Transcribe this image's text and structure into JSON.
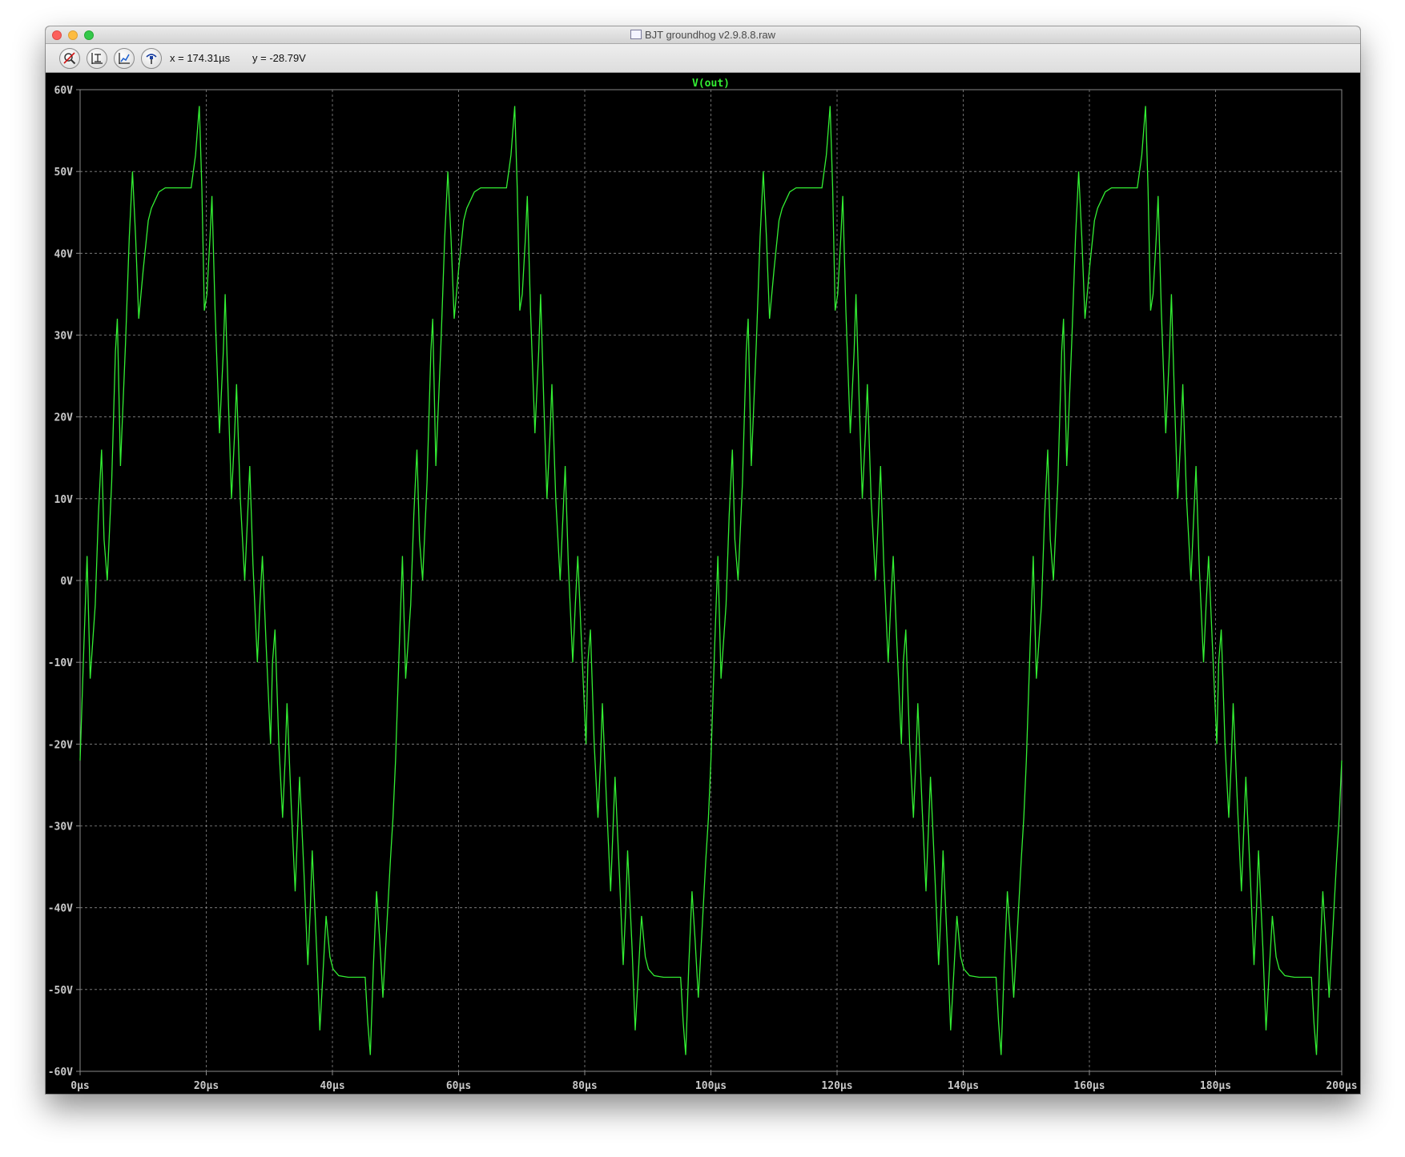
{
  "window": {
    "title": "BJT groundhog v2.9.8.8.raw"
  },
  "toolbar": {
    "buttons": [
      {
        "name": "zoom-cancel-icon"
      },
      {
        "name": "zoom-full-icon"
      },
      {
        "name": "zoom-fit-icon"
      },
      {
        "name": "probe-icon"
      }
    ],
    "cursor_x": "x = 174.31µs",
    "cursor_y": "y = -28.79V"
  },
  "colors": {
    "trace": "#33ee33",
    "grid": "#8a8a8a",
    "axis_text": "#c8c8c8",
    "background": "#000000"
  },
  "chart_data": {
    "type": "line",
    "title": "V(out)",
    "xlabel": "",
    "ylabel": "",
    "xlim": [
      0,
      200
    ],
    "ylim": [
      -60,
      60
    ],
    "x_unit": "µs",
    "y_unit": "V",
    "x_ticks": [
      "0µs",
      "20µs",
      "40µs",
      "60µs",
      "80µs",
      "100µs",
      "120µs",
      "140µs",
      "160µs",
      "180µs",
      "200µs"
    ],
    "y_ticks": [
      "60V",
      "50V",
      "40V",
      "30V",
      "20V",
      "10V",
      "0V",
      "-10V",
      "-20V",
      "-30V",
      "-40V",
      "-50V",
      "-60V"
    ],
    "grid": true,
    "series": [
      {
        "name": "V(out)",
        "period": 50,
        "cycle_points": [
          [
            0.0,
            -22
          ],
          [
            0.6,
            -8
          ],
          [
            1.1,
            3
          ],
          [
            1.6,
            -12
          ],
          [
            2.4,
            -3
          ],
          [
            2.9,
            8
          ],
          [
            3.4,
            16
          ],
          [
            3.8,
            5
          ],
          [
            4.3,
            0
          ],
          [
            5.0,
            12
          ],
          [
            5.6,
            28
          ],
          [
            5.9,
            32
          ],
          [
            6.4,
            14
          ],
          [
            7.2,
            29
          ],
          [
            7.8,
            42
          ],
          [
            8.3,
            50
          ],
          [
            8.8,
            42
          ],
          [
            9.3,
            32
          ],
          [
            10.0,
            38
          ],
          [
            10.8,
            44
          ],
          [
            11.3,
            45.5
          ],
          [
            12.5,
            47.5
          ],
          [
            13.5,
            48
          ],
          [
            14.5,
            48
          ],
          [
            15.5,
            48
          ],
          [
            16.5,
            48
          ],
          [
            17.6,
            48
          ],
          [
            18.3,
            52
          ],
          [
            18.9,
            58
          ],
          [
            19.3,
            48
          ],
          [
            19.7,
            33
          ],
          [
            20.1,
            35
          ],
          [
            20.6,
            42
          ],
          [
            20.9,
            47
          ],
          [
            21.4,
            33
          ],
          [
            22.1,
            18
          ],
          [
            22.7,
            28
          ],
          [
            23.0,
            35
          ],
          [
            23.5,
            22
          ],
          [
            24.0,
            10
          ],
          [
            24.5,
            18
          ],
          [
            24.8,
            24
          ],
          [
            25.4,
            10
          ],
          [
            26.1,
            0
          ],
          [
            26.5,
            7
          ],
          [
            26.9,
            14
          ],
          [
            27.4,
            2
          ],
          [
            28.1,
            -10
          ],
          [
            28.5,
            -3
          ],
          [
            28.9,
            3
          ],
          [
            29.5,
            -8
          ],
          [
            30.2,
            -20
          ],
          [
            30.5,
            -10
          ],
          [
            30.9,
            -6
          ],
          [
            31.5,
            -20
          ],
          [
            32.1,
            -29
          ],
          [
            32.5,
            -22
          ],
          [
            32.8,
            -15
          ],
          [
            33.5,
            -28
          ],
          [
            34.1,
            -38
          ],
          [
            34.5,
            -30
          ],
          [
            34.8,
            -24
          ],
          [
            35.5,
            -36
          ],
          [
            36.1,
            -47
          ],
          [
            36.5,
            -40
          ],
          [
            36.8,
            -33
          ],
          [
            37.5,
            -45
          ],
          [
            38.0,
            -55
          ],
          [
            38.5,
            -48
          ],
          [
            39.0,
            -41
          ],
          [
            39.6,
            -46
          ],
          [
            40.1,
            -47.5
          ],
          [
            41.0,
            -48.3
          ],
          [
            42.5,
            -48.5
          ],
          [
            44.0,
            -48.5
          ],
          [
            45.2,
            -48.5
          ],
          [
            45.6,
            -54
          ],
          [
            46.0,
            -58
          ],
          [
            46.5,
            -47
          ],
          [
            47.0,
            -38
          ],
          [
            47.5,
            -44
          ],
          [
            48.0,
            -51
          ],
          [
            48.5,
            -44
          ],
          [
            49.2,
            -34
          ],
          [
            49.6,
            -29
          ],
          [
            50.0,
            -22
          ]
        ],
        "cycles_drawn": 4
      }
    ]
  }
}
